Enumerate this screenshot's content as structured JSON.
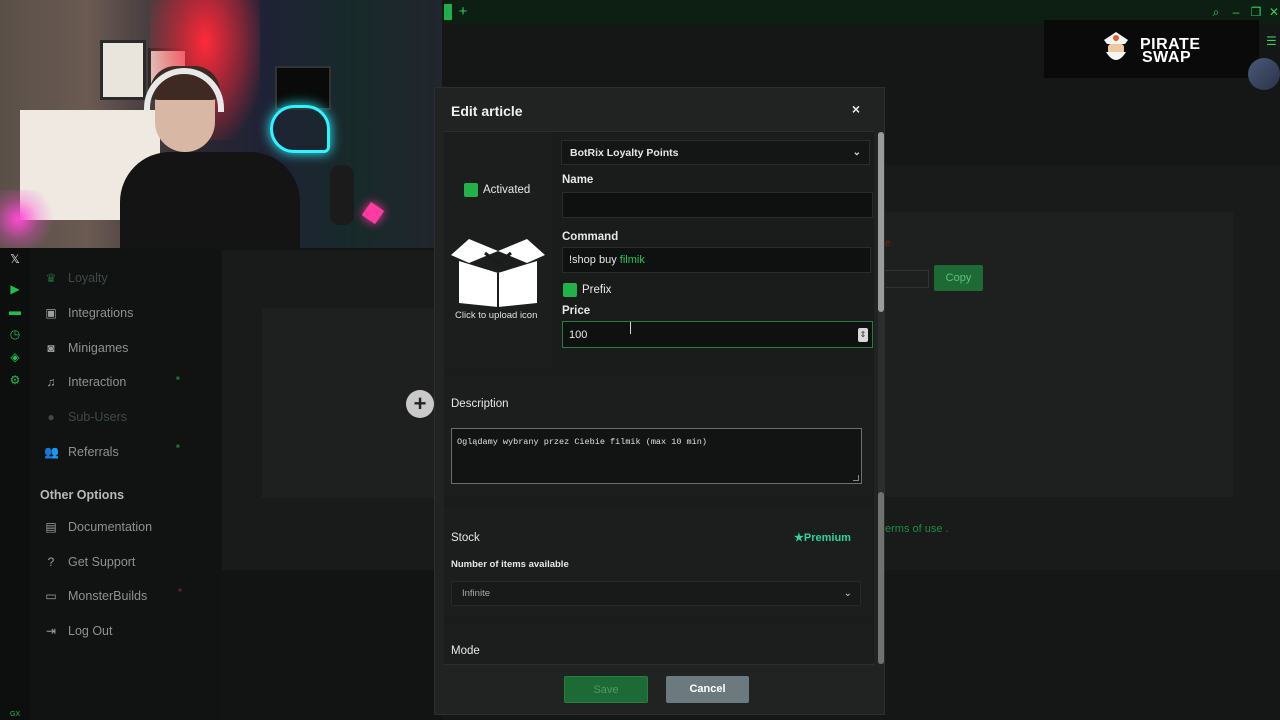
{
  "logo": {
    "line1": "PIRATE",
    "line2": "SWAP"
  },
  "sidebar": {
    "items": [
      {
        "label": "Loyalty",
        "icon": "trophy-icon"
      },
      {
        "label": "Integrations",
        "icon": "puzzle-icon"
      },
      {
        "label": "Minigames",
        "icon": "gamepad-icon"
      },
      {
        "label": "Interaction",
        "icon": "music-icon"
      },
      {
        "label": "Sub-Users",
        "icon": "user-icon"
      },
      {
        "label": "Referrals",
        "icon": "users-icon"
      }
    ],
    "other_heading": "Other Options",
    "other_items": [
      {
        "label": "Documentation",
        "icon": "book-icon"
      },
      {
        "label": "Get Support",
        "icon": "help-icon"
      },
      {
        "label": "MonsterBuilds",
        "icon": "monitor-icon"
      },
      {
        "label": "Log Out",
        "icon": "logout-icon"
      }
    ]
  },
  "background": {
    "copy_label": "Copy",
    "terms_text": "erms of use ."
  },
  "modal": {
    "title": "Edit article",
    "close": "×",
    "currency_select": "BotRix Loyalty Points",
    "activated_label": "Activated",
    "upload_label": "Click to upload icon",
    "name_label": "Name",
    "name_value": "",
    "command_label": "Command",
    "command_prefix": "!shop buy",
    "command_value": "filmik",
    "prefix_label": "Prefix",
    "price_label": "Price",
    "price_value": "100",
    "description_label": "Description",
    "description_value": "Oglądamy wybrany przez Ciebie filmik (max 10 min)",
    "stock_label": "Stock",
    "premium_label": "Premium",
    "stock_sub_label": "Number of items available",
    "stock_value": "Infinite",
    "mode_label": "Mode",
    "save_label": "Save",
    "cancel_label": "Cancel"
  },
  "colors": {
    "accent": "#23b24a",
    "bg": "#121414",
    "modal": "#212322"
  }
}
